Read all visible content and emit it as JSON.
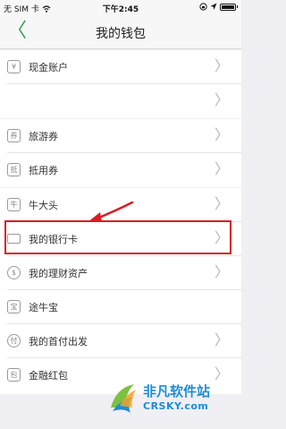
{
  "status_bar": {
    "carrier": "无 SIM 卡",
    "time": "下午2:45"
  },
  "nav": {
    "title": "我的钱包",
    "back_icon": "chevron-left-icon"
  },
  "menu": {
    "cash_account": "现金账户",
    "travel_voucher": "旅游券",
    "deduction_voucher": "抵用券",
    "niudatou": "牛大头",
    "bank_card": "我的银行卡",
    "assets": "我的理财资产",
    "tuniubao": "途牛宝",
    "first_pay": "我的首付出发",
    "red_packet": "金融红包"
  },
  "colors": {
    "accent": "#2e9e4d",
    "highlight": "#d61f26"
  },
  "watermark": {
    "brand": "非凡软件站",
    "site": "CRSKY.com"
  }
}
